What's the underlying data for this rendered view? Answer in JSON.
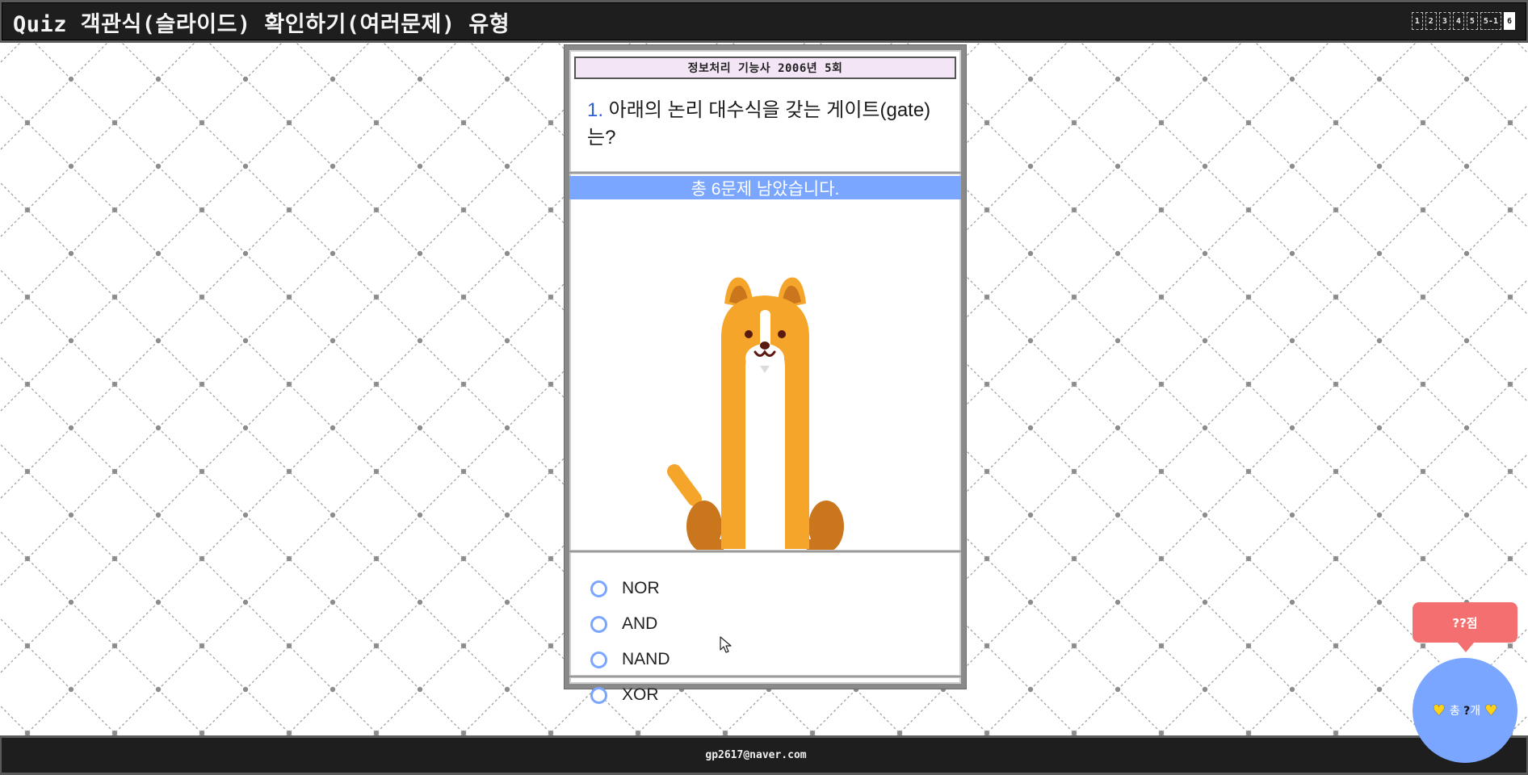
{
  "app": {
    "title": "Quiz 객관식(슬라이드) 확인하기(여러문제) 유형"
  },
  "page_nav": {
    "pages": [
      "1",
      "2",
      "3",
      "4",
      "5",
      "5-1",
      "6"
    ],
    "active_page": "6"
  },
  "quiz": {
    "exam_label": "정보처리 기능사 2006년 5회",
    "question_number": "1.",
    "question_text": " 아래의 논리 대수식을 갖는 게이트(gate)는?",
    "remaining_text": "총 6문제 남았습니다.",
    "options": [
      {
        "label": "NOR"
      },
      {
        "label": "AND"
      },
      {
        "label": "NAND"
      },
      {
        "label": "XOR"
      }
    ]
  },
  "score": {
    "bubble_text": "??점",
    "total_prefix": "총",
    "total_qm": "?",
    "total_suffix": "개"
  },
  "footer": {
    "email": "gp2617@naver.com"
  },
  "colors": {
    "accent": "#7aa6ff",
    "score_bubble": "#f46f6f",
    "exam_label_bg": "#f3e4f6",
    "dog_orange": "#f5a52a",
    "dog_dark": "#c9761c",
    "bar_dark": "#1e1e1e"
  },
  "icons": {
    "radio": "radio-circle-icon",
    "heart": "heart-icon",
    "mascot": "dog-mascot-icon",
    "cursor": "mouse-cursor-icon"
  }
}
